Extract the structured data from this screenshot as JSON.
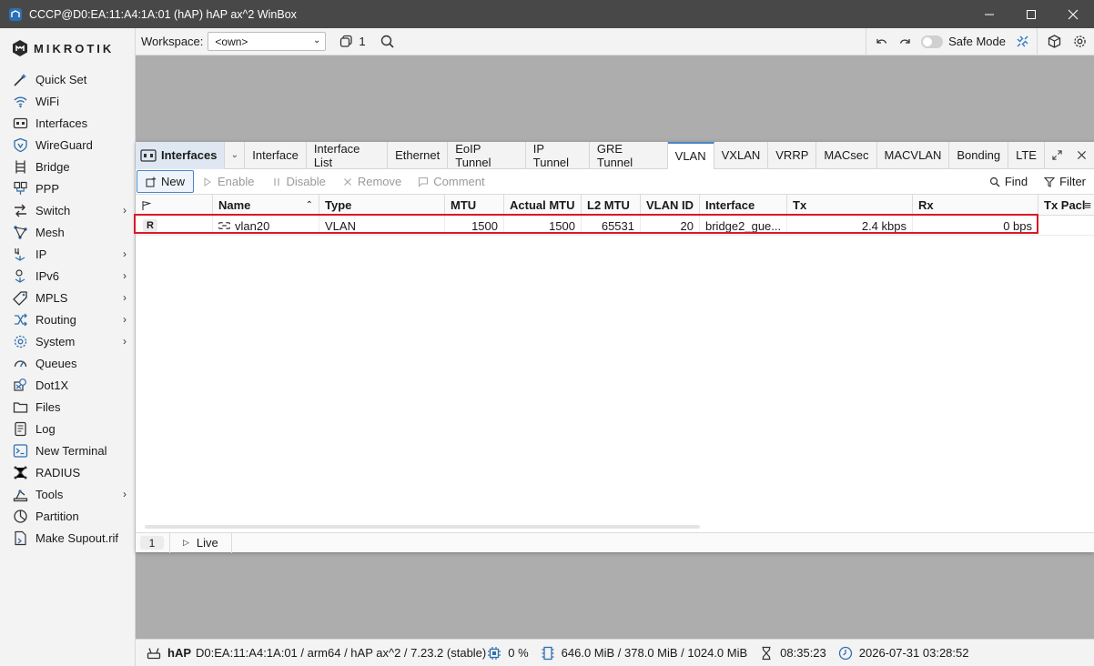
{
  "window": {
    "title": "CCCP@D0:EA:11:A4:1A:01 (hAP) hAP ax^2 WinBox"
  },
  "brand": {
    "logo_text": "MIKROTIK",
    "accent": "#4a86c5",
    "highlight": "#d9192a"
  },
  "sidebar": {
    "items": [
      {
        "label": "Quick Set",
        "icon": "quick-set-icon",
        "submenu": false
      },
      {
        "label": "WiFi",
        "icon": "wifi-icon",
        "submenu": false
      },
      {
        "label": "Interfaces",
        "icon": "interfaces-icon",
        "submenu": false
      },
      {
        "label": "WireGuard",
        "icon": "wireguard-icon",
        "submenu": false
      },
      {
        "label": "Bridge",
        "icon": "bridge-icon",
        "submenu": false
      },
      {
        "label": "PPP",
        "icon": "ppp-icon",
        "submenu": false
      },
      {
        "label": "Switch",
        "icon": "switch-icon",
        "submenu": true
      },
      {
        "label": "Mesh",
        "icon": "mesh-icon",
        "submenu": false
      },
      {
        "label": "IP",
        "icon": "ip-icon",
        "submenu": true
      },
      {
        "label": "IPv6",
        "icon": "ipv6-icon",
        "submenu": true
      },
      {
        "label": "MPLS",
        "icon": "mpls-icon",
        "submenu": true
      },
      {
        "label": "Routing",
        "icon": "routing-icon",
        "submenu": true
      },
      {
        "label": "System",
        "icon": "system-icon",
        "submenu": true
      },
      {
        "label": "Queues",
        "icon": "queues-icon",
        "submenu": false
      },
      {
        "label": "Dot1X",
        "icon": "dot1x-icon",
        "submenu": false
      },
      {
        "label": "Files",
        "icon": "files-icon",
        "submenu": false
      },
      {
        "label": "Log",
        "icon": "log-icon",
        "submenu": false
      },
      {
        "label": "New Terminal",
        "icon": "terminal-icon",
        "submenu": false
      },
      {
        "label": "RADIUS",
        "icon": "radius-icon",
        "submenu": false
      },
      {
        "label": "Tools",
        "icon": "tools-icon",
        "submenu": true
      },
      {
        "label": "Partition",
        "icon": "partition-icon",
        "submenu": false
      },
      {
        "label": "Make Supout.rif",
        "icon": "supout-icon",
        "submenu": false
      }
    ]
  },
  "toolbar": {
    "workspace_label": "Workspace:",
    "workspace_value": "<own>",
    "windows_count": "1",
    "safe_mode_label": "Safe Mode"
  },
  "interfaces_window": {
    "title": "Interfaces",
    "tabs": [
      "Interface",
      "Interface List",
      "Ethernet",
      "EoIP Tunnel",
      "IP Tunnel",
      "GRE Tunnel",
      "VLAN",
      "VXLAN",
      "VRRP",
      "MACsec",
      "MACVLAN",
      "Bonding",
      "LTE"
    ],
    "active_tab": "VLAN",
    "actions": {
      "new": "New",
      "enable": "Enable",
      "disable": "Disable",
      "remove": "Remove",
      "comment": "Comment",
      "find": "Find",
      "filter": "Filter"
    },
    "columns": [
      "",
      "Name",
      "Type",
      "MTU",
      "Actual MTU",
      "L2 MTU",
      "VLAN ID",
      "Interface",
      "Tx",
      "Rx",
      "Tx Pacl"
    ],
    "rows": [
      {
        "flag": "R",
        "name": "vlan20",
        "type": "VLAN",
        "mtu": "1500",
        "actual_mtu": "1500",
        "l2_mtu": "65531",
        "vlan_id": "20",
        "interface": "bridge2_gue...",
        "tx": "2.4 kbps",
        "rx": "0 bps"
      }
    ],
    "footer": {
      "count": "1",
      "live_label": "Live"
    }
  },
  "statusbar": {
    "device": "hAP",
    "details": "D0:EA:11:A4:1A:01 / arm64 / hAP ax^2 / 7.23.2 (stable)",
    "cpu": "0 %",
    "memory": "646.0 MiB / 378.0 MiB / 1024.0 MiB",
    "uptime": "08:35:23",
    "datetime": "2026-07-31 03:28:52"
  }
}
